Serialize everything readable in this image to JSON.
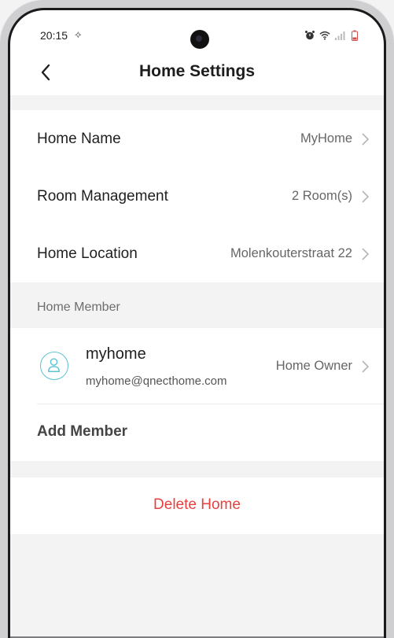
{
  "status_bar": {
    "time": "20:15",
    "extra_indicator": "⟡",
    "icons": [
      "alarm-icon",
      "wifi-icon",
      "signal-icon",
      "battery-icon"
    ]
  },
  "header": {
    "title": "Home Settings",
    "back_icon": "chevron-left-icon"
  },
  "home_info": {
    "rows": [
      {
        "label": "Home Name",
        "value": "MyHome"
      },
      {
        "label": "Room Management",
        "value": "2 Room(s)"
      },
      {
        "label": "Home Location",
        "value": "Molenkouterstraat 22"
      }
    ]
  },
  "members": {
    "section_title": "Home Member",
    "list": [
      {
        "name": "myhome",
        "email": "myhome@qnecthome.com",
        "role": "Home Owner"
      }
    ],
    "add_label": "Add Member"
  },
  "actions": {
    "delete_label": "Delete Home"
  },
  "colors": {
    "accent_teal": "#5cc3d0",
    "danger": "#e8403f",
    "background": "#f3f3f3"
  }
}
